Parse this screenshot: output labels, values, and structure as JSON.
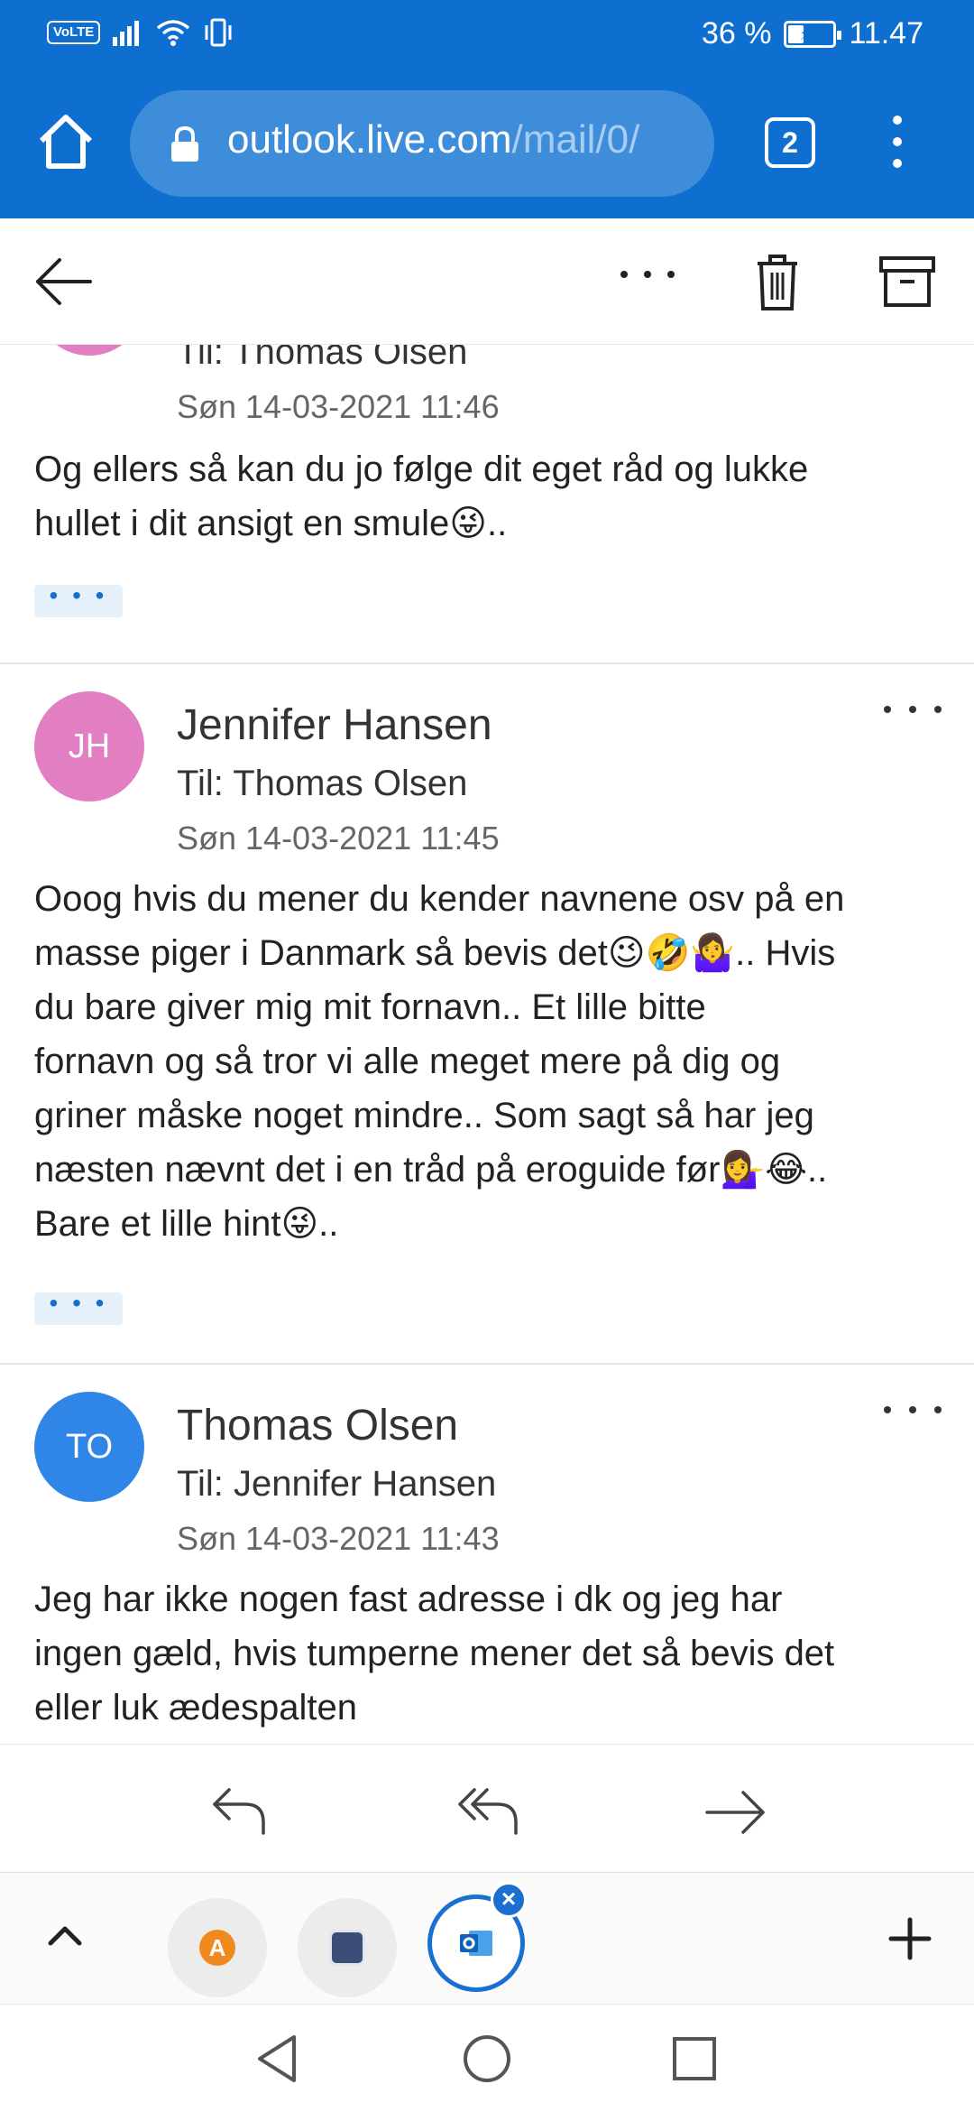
{
  "status_bar": {
    "volte": "VoLTE",
    "battery_percent": "36 %",
    "battery_level": 0.36,
    "time": "11.47"
  },
  "browser": {
    "url_main": "outlook.live.com",
    "url_path": "/mail/0/",
    "tab_count": "2"
  },
  "toolbar": {
    "back_icon": "arrow-left-icon",
    "more_icon": "more-horizontal-icon",
    "delete_icon": "trash-icon",
    "archive_icon": "archive-icon"
  },
  "messages": [
    {
      "recipient": "Til: Thomas Olsen",
      "date": "Søn 14-03-2021 11:46",
      "body_lines": [
        "Og ellers så kan du jo følge dit eget råd og lukke",
        "hullet i dit ansigt en smule😜.."
      ],
      "avatar_color": "#e27fc2"
    },
    {
      "initials": "JH",
      "sender": "Jennifer Hansen",
      "recipient": "Til: Thomas Olsen",
      "date": "Søn 14-03-2021 11:45",
      "body_lines": [
        "Ooog hvis du mener du kender navnene osv på en",
        "masse piger i Danmark så bevis det😉🤣🤷‍♀️.. Hvis",
        "du bare giver mig mit fornavn.. Et lille bitte",
        "fornavn og så tror vi alle meget mere på dig og",
        "griner måske noget mindre.. Som sagt så har jeg",
        "næsten nævnt det i en tråd på eroguide før💁‍♀️😂..",
        "Bare et lille hint😜.."
      ],
      "avatar_color": "#e27fc2"
    },
    {
      "initials": "TO",
      "sender": "Thomas Olsen",
      "recipient": "Til: Jennifer Hansen",
      "date": "Søn 14-03-2021 11:43",
      "body_lines": [
        "Jeg har ikke nogen fast adresse i dk og jeg har",
        "ingen gæld, hvis tumperne mener det så bevis det",
        "eller luk ædespalten"
      ],
      "avatar_color": "#2f86e6"
    }
  ],
  "expand_label": "• • •",
  "reply_bar": {
    "reply_icon": "reply-icon",
    "reply_all_icon": "reply-all-icon",
    "forward_icon": "forward-icon"
  },
  "app_switcher": {
    "close_badge": "×",
    "apps": [
      "avast-app",
      "golf-app",
      "outlook-app"
    ]
  },
  "colors": {
    "brand_blue": "#0f6fd0",
    "url_pill": "#3e8ddb",
    "link_blue": "#1c6fc7"
  }
}
